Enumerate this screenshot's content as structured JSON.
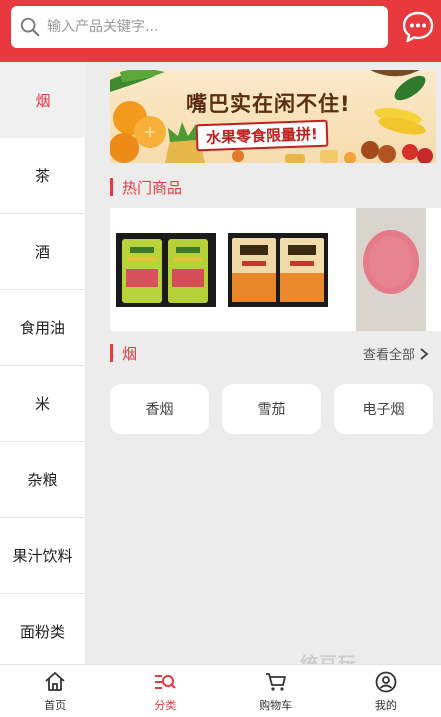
{
  "search": {
    "placeholder": "输入产品关键字..."
  },
  "sidebar": {
    "items": [
      {
        "label": "烟",
        "active": true
      },
      {
        "label": "茶"
      },
      {
        "label": "酒"
      },
      {
        "label": "食用油"
      },
      {
        "label": "米"
      },
      {
        "label": "杂粮"
      },
      {
        "label": "果汁饮料"
      },
      {
        "label": "面粉类"
      }
    ]
  },
  "banner": {
    "title": "嘴巴实在闲不住!",
    "subtitle": "水果零食限量拼!"
  },
  "hot": {
    "title": "热门商品"
  },
  "category": {
    "title": "烟",
    "view_all": "查看全部",
    "chips": [
      "香烟",
      "雪茄",
      "电子烟"
    ]
  },
  "tabbar": {
    "items": [
      {
        "label": "首页",
        "icon": "home-icon"
      },
      {
        "label": "分类",
        "icon": "category-icon",
        "active": true
      },
      {
        "label": "购物车",
        "icon": "cart-icon"
      },
      {
        "label": "我的",
        "icon": "profile-icon"
      }
    ]
  },
  "watermark": "统豆玩",
  "colors": {
    "accent": "#e8393f",
    "background": "#ececec"
  }
}
